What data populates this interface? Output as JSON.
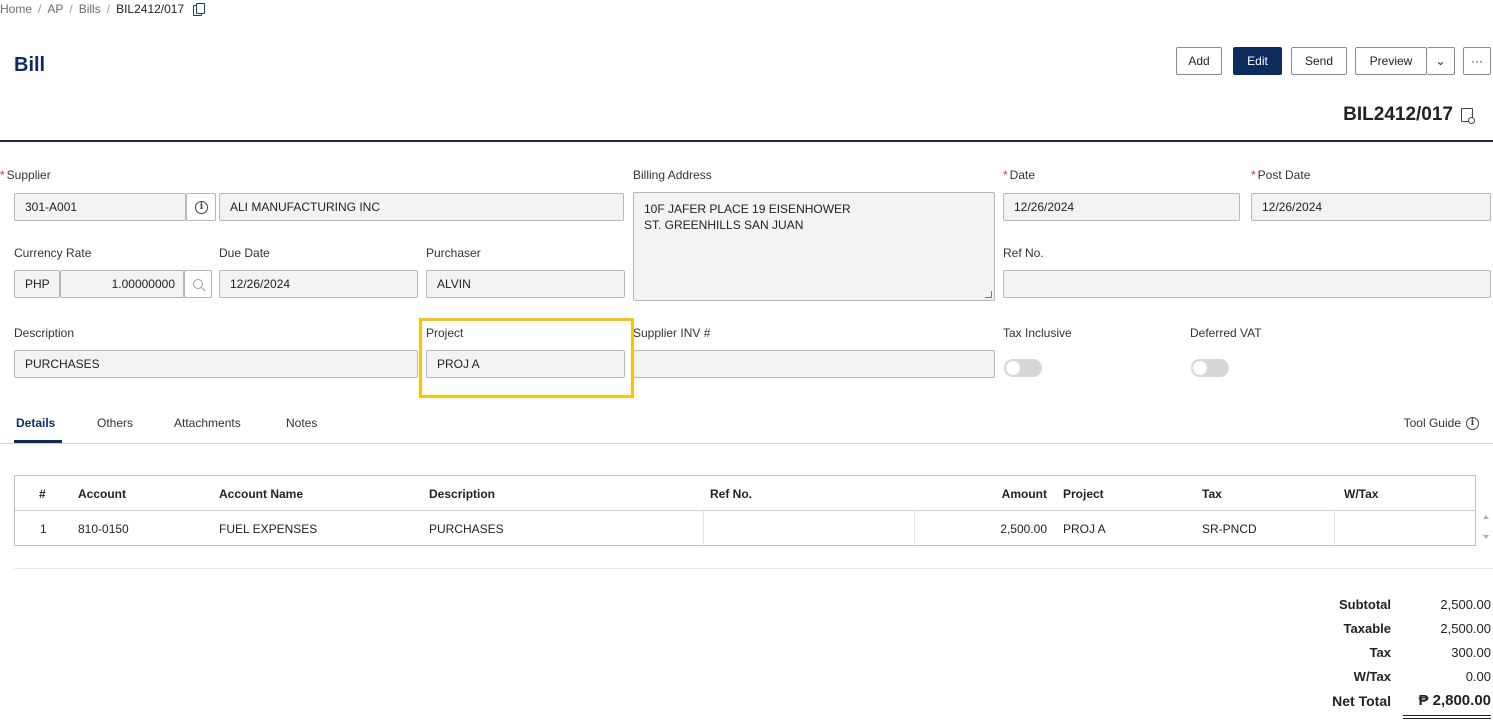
{
  "breadcrumb": {
    "home": "Home",
    "ap": "AP",
    "bills": "Bills",
    "current": "BIL2412/017",
    "separator": "/"
  },
  "page_title": "Bill",
  "toolbar": {
    "add": "Add",
    "edit": "Edit",
    "send": "Send",
    "preview": "Preview",
    "preview_caret": "⌄",
    "more": "···"
  },
  "doc_number": "BIL2412/017",
  "form": {
    "required_mark": "*",
    "supplier_label": "Supplier",
    "supplier_code": "301-A001",
    "supplier_name": "ALI MANUFACTURING INC",
    "billing_address_label": "Billing Address",
    "billing_address": "10F JAFER PLACE 19 EISENHOWER ST. GREENHILLS SAN JUAN",
    "date_label": "Date",
    "date": "12/26/2024",
    "post_date_label": "Post Date",
    "post_date": "12/26/2024",
    "currency_rate_label": "Currency Rate",
    "currency": "PHP",
    "rate": "1.00000000",
    "due_date_label": "Due Date",
    "due_date": "12/26/2024",
    "purchaser_label": "Purchaser",
    "purchaser": "ALVIN",
    "ref_no_label": "Ref No.",
    "ref_no": "",
    "description_label": "Description",
    "description": "PURCHASES",
    "project_label": "Project",
    "project": "PROJ A",
    "supplier_inv_label": "Supplier INV #",
    "supplier_inv": "",
    "tax_inclusive_label": "Tax Inclusive",
    "tax_inclusive": false,
    "deferred_vat_label": "Deferred VAT",
    "deferred_vat": false,
    "info_glyph": "i"
  },
  "tabs": [
    "Details",
    "Others",
    "Attachments",
    "Notes"
  ],
  "active_tab": "Details",
  "tool_guide": "Tool Guide",
  "grid": {
    "headers": [
      "#",
      "Account",
      "Account Name",
      "Description",
      "Ref No.",
      "Amount",
      "Project",
      "Tax",
      "W/Tax"
    ],
    "rows": [
      [
        "1",
        "810-0150",
        "FUEL EXPENSES",
        "PURCHASES",
        "",
        "2,500.00",
        "PROJ A",
        "SR-PNCD",
        ""
      ]
    ]
  },
  "totals": {
    "subtotal_label": "Subtotal",
    "subtotal": "2,500.00",
    "taxable_label": "Taxable",
    "taxable": "2,500.00",
    "tax_label": "Tax",
    "tax": "300.00",
    "wtax_label": "W/Tax",
    "wtax": "0.00",
    "net_total_label": "Net Total",
    "net_total": "₱ 2,800.00"
  },
  "colors": {
    "brand": "#0d2c5e",
    "highlight": "#f5c11a",
    "required": "#d9342b"
  }
}
